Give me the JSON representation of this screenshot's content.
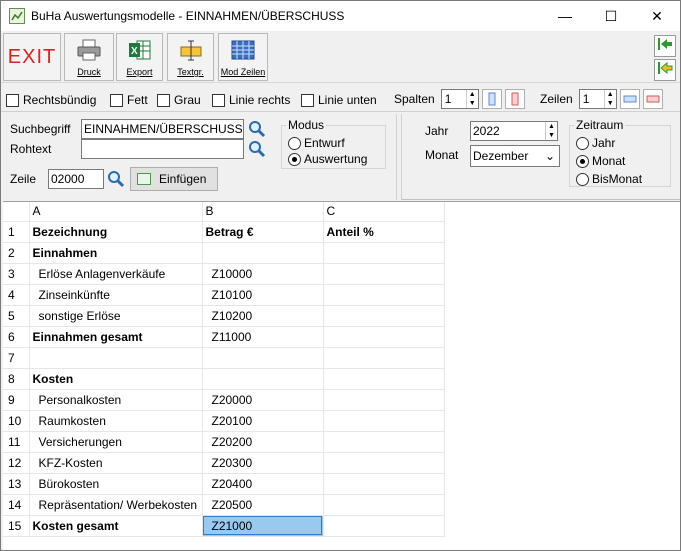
{
  "window": {
    "title": "BuHa Auswertungsmodelle - EINNAHMEN/ÜBERSCHUSS",
    "min": "—",
    "max": "☐",
    "close": "✕"
  },
  "toolbar": {
    "exit": "EXIT",
    "druck": "Druck",
    "export": "Export",
    "textgr": "Textgr.",
    "modzeilen": "Mod Zeilen"
  },
  "options": {
    "rechtsbuendig": "Rechtsbündig",
    "fett": "Fett",
    "grau": "Grau",
    "linie_rechts": "Linie rechts",
    "linie_unten": "Linie unten",
    "spalten_label": "Spalten",
    "spalten_value": "1",
    "zeilen_label": "Zeilen",
    "zeilen_value": "1"
  },
  "search": {
    "suchbegriff_label": "Suchbegriff",
    "suchbegriff_value": "EINNAHMEN/ÜBERSCHUSS",
    "rohtext_label": "Rohtext",
    "rohtext_value": "",
    "zeile_label": "Zeile",
    "zeile_value": "02000",
    "einfuegen": "Einfügen"
  },
  "modus": {
    "title": "Modus",
    "entwurf": "Entwurf",
    "auswertung": "Auswertung",
    "selected": "Auswertung"
  },
  "period": {
    "jahr_label": "Jahr",
    "jahr_value": "2022",
    "monat_label": "Monat",
    "monat_value": "Dezember",
    "zeitraum_title": "Zeitraum",
    "zr_jahr": "Jahr",
    "zr_monat": "Monat",
    "zr_bismonat": "BisMonat",
    "selected": "Monat"
  },
  "grid": {
    "columns": [
      "A",
      "B",
      "C"
    ],
    "rows": [
      {
        "n": "1",
        "a": "Bezeichnung",
        "b": "Betrag €",
        "c": "Anteil %"
      },
      {
        "n": "2",
        "a": "Einnahmen",
        "b": "",
        "c": ""
      },
      {
        "n": "3",
        "a": "Erlöse Anlagenverkäufe",
        "b": "Z10000",
        "c": ""
      },
      {
        "n": "4",
        "a": "Zinseinkünfte",
        "b": "Z10100",
        "c": ""
      },
      {
        "n": "5",
        "a": "sonstige Erlöse",
        "b": "Z10200",
        "c": ""
      },
      {
        "n": "6",
        "a": "Einnahmen gesamt",
        "b": "Z11000",
        "c": ""
      },
      {
        "n": "7",
        "a": "",
        "b": "",
        "c": ""
      },
      {
        "n": "8",
        "a": "Kosten",
        "b": "",
        "c": ""
      },
      {
        "n": "9",
        "a": "Personalkosten",
        "b": "Z20000",
        "c": ""
      },
      {
        "n": "10",
        "a": "Raumkosten",
        "b": "Z20100",
        "c": ""
      },
      {
        "n": "11",
        "a": "Versicherungen",
        "b": "Z20200",
        "c": ""
      },
      {
        "n": "12",
        "a": "KFZ-Kosten",
        "b": "Z20300",
        "c": ""
      },
      {
        "n": "13",
        "a": "Bürokosten",
        "b": "Z20400",
        "c": ""
      },
      {
        "n": "14",
        "a": "Repräsentation/ Werbekosten",
        "b": "Z20500",
        "c": ""
      },
      {
        "n": "15",
        "a": "Kosten gesamt",
        "b": "Z21000",
        "c": ""
      }
    ]
  }
}
